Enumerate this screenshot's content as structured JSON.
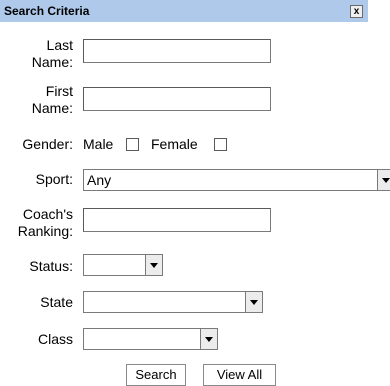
{
  "panel": {
    "title": "Search Criteria",
    "close_label": "x"
  },
  "fields": {
    "last_name": {
      "label_line1": "Last",
      "label_line2": "Name:",
      "value": ""
    },
    "first_name": {
      "label_line1": "First",
      "label_line2": "Name:",
      "value": ""
    },
    "gender": {
      "label": "Gender:",
      "male_label": "Male",
      "female_label": "Female"
    },
    "sport": {
      "label": "Sport:",
      "selected": "Any"
    },
    "coach_ranking": {
      "label_line1": "Coach's",
      "label_line2": "Ranking:",
      "value": ""
    },
    "status": {
      "label": "Status:",
      "selected": ""
    },
    "state": {
      "label": "State",
      "selected": ""
    },
    "class": {
      "label": "Class",
      "selected": ""
    }
  },
  "buttons": {
    "search": "Search",
    "view_all": "View All"
  }
}
